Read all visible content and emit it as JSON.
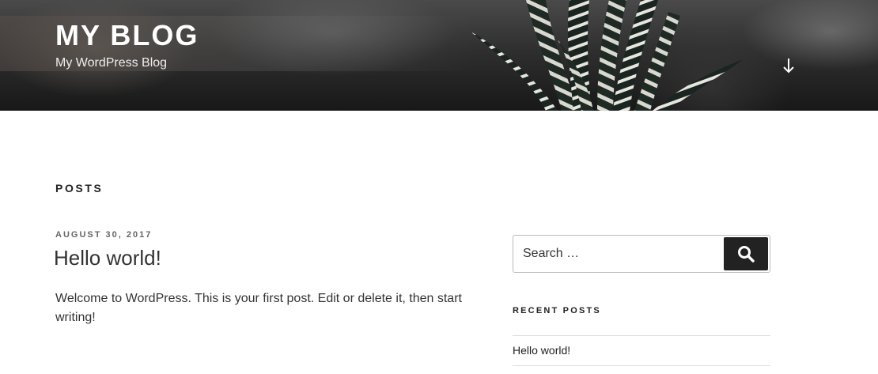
{
  "header": {
    "site_title": "MY BLOG",
    "site_description": "My WordPress Blog",
    "scroll_icon": "arrow-down-icon"
  },
  "main": {
    "page_heading": "POSTS",
    "posts": [
      {
        "date": "AUGUST 30, 2017",
        "title": "Hello world!",
        "excerpt": "Welcome to WordPress. This is your first post. Edit or delete it, then start writing!"
      }
    ]
  },
  "sidebar": {
    "search": {
      "placeholder": "Search …",
      "button_icon": "search-icon"
    },
    "recent_posts": {
      "title": "RECENT POSTS",
      "items": [
        "Hello world!"
      ]
    }
  },
  "colors": {
    "text": "#333333",
    "heading": "#222222",
    "search_button": "#222222"
  }
}
